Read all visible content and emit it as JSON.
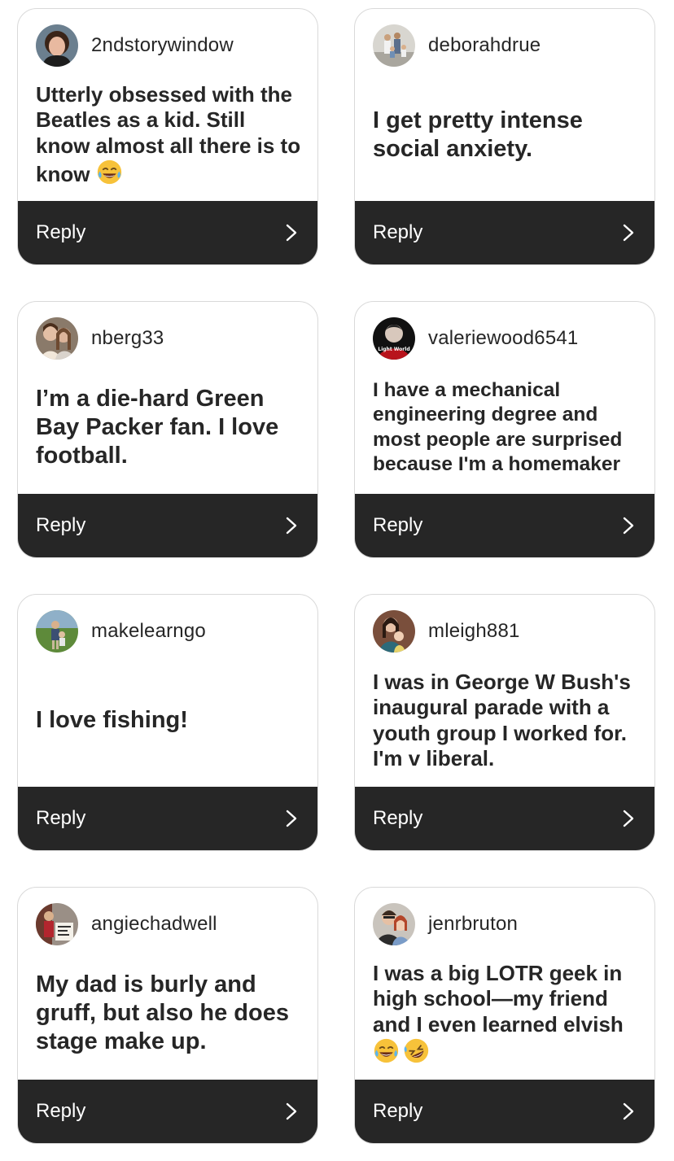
{
  "reply_label": "Reply",
  "cards": [
    {
      "username": "2ndstorywindow",
      "text": "Utterly obsessed with the Beatles as a kid. Still know almost all there is to know",
      "emojis": [
        "face-with-tears-of-joy-emoji"
      ],
      "avatar": "avatar-woman-portrait"
    },
    {
      "username": "deborahdrue",
      "text": "I get pretty intense social anxiety.",
      "emojis": [],
      "avatar": "avatar-family-photo"
    },
    {
      "username": "nberg33",
      "text": "I’m a die-hard Green Bay Packer fan. I love football.",
      "emojis": [],
      "avatar": "avatar-two-people"
    },
    {
      "username": "valeriewood6541",
      "text": "I have a mechanical engineering degree and most people are surprised because I'm a homemaker",
      "emojis": [],
      "avatar": "avatar-light-world-logo",
      "avatar_text": "Light World"
    },
    {
      "username": "makelearngo",
      "text": "I love fishing!",
      "emojis": [],
      "avatar": "avatar-outdoor-person"
    },
    {
      "username": "mleigh881",
      "text": "I was in George W Bush's inaugural parade with a youth group I worked for. I'm v liberal.",
      "emojis": [],
      "avatar": "avatar-mother-child"
    },
    {
      "username": "angiechadwell",
      "text": "My dad is burly and gruff, but also he does stage make up.",
      "emojis": [],
      "avatar": "avatar-person-with-sign"
    },
    {
      "username": "jenrbruton",
      "text": "I was a big LOTR geek in high school—my friend and I even learned elvish",
      "emojis": [
        "face-with-tears-of-joy-emoji",
        "rolling-on-the-floor-laughing-emoji"
      ],
      "avatar": "avatar-couple-selfie"
    }
  ],
  "colors": {
    "reply_bar": "#262626",
    "card_border": "#d9d9d9",
    "text": "#262626"
  }
}
